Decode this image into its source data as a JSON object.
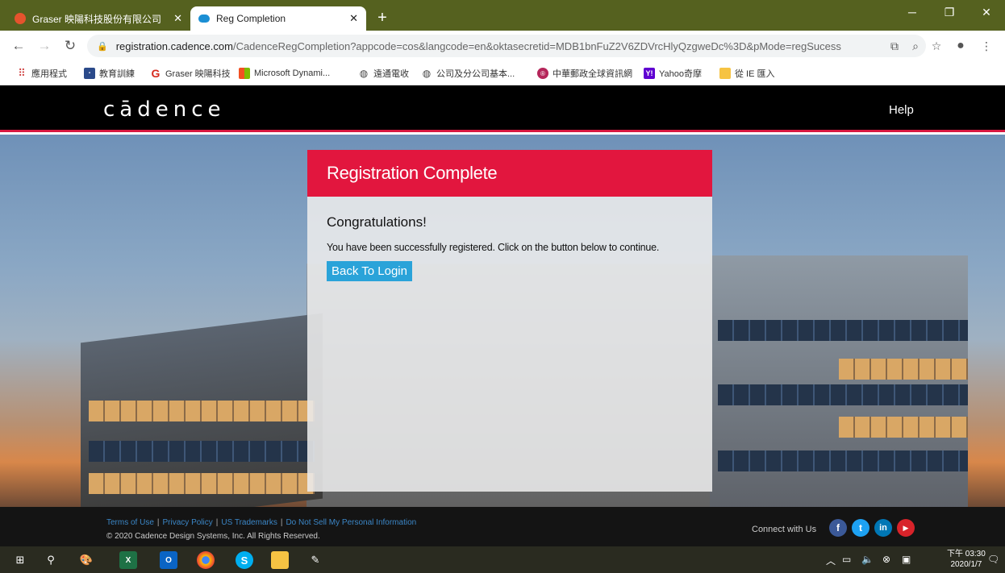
{
  "browser": {
    "tabs": [
      {
        "title": "Graser 映陽科技股份有限公司",
        "active": false
      },
      {
        "title": "Reg Completion",
        "active": true
      }
    ],
    "new_tab": "+",
    "url_host": "registration.cadence.com",
    "url_rest": "/CadenceRegCompletion?appcode=cos&langcode=en&oktasecretid=MDB1bnFuZ2V6ZDVrcHlyQzgweDc%3D&pMode=regSucess",
    "bookmarks": [
      "應用程式",
      "教育訓練",
      "Graser 映陽科技",
      "Microsoft Dynami...",
      "遠通電收",
      "公司及分公司基本...",
      "中華郵政全球資訊網",
      "Yahoo奇摩",
      "從 IE 匯入"
    ]
  },
  "site": {
    "logo": "cādence",
    "help": "Help"
  },
  "card": {
    "title": "Registration Complete",
    "congrats": "Congratulations!",
    "message": "You have been successfully registered. Click on the button below to continue.",
    "button": "Back To Login"
  },
  "footer": {
    "links": [
      "Terms of Use",
      "Privacy Policy",
      "US Trademarks",
      "Do Not Sell My Personal Information"
    ],
    "copyright": "© 2020 Cadence Design Systems, Inc. All Rights Reserved.",
    "connect": "Connect with Us",
    "social": [
      "facebook-icon",
      "twitter-icon",
      "linkedin-icon",
      "youtube-icon"
    ]
  },
  "taskbar": {
    "time": "下午 03:30",
    "date": "2020/1/7"
  },
  "colors": {
    "tabstrip": "#55611f",
    "accent_red": "#e2163e",
    "button_blue": "#2aa3d9"
  }
}
